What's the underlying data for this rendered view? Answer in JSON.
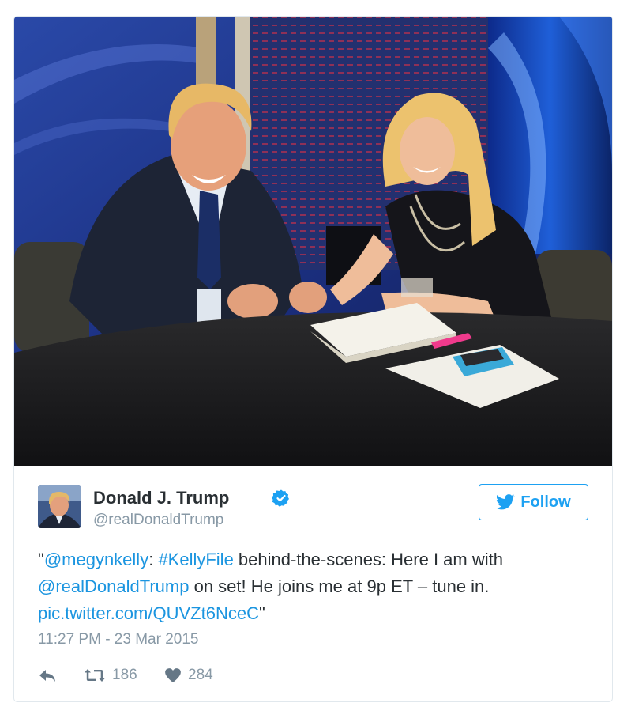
{
  "author": {
    "display_name": "Donald J. Trump",
    "handle": "@realDonaldTrump",
    "verified": true
  },
  "follow_button": {
    "label": "Follow"
  },
  "tweet": {
    "quote_open": "\"",
    "mention_1": "@megynkelly",
    "colon": ": ",
    "hashtag": "#KellyFile",
    "text_1": " behind-the-scenes: Here I am with ",
    "mention_2": "@realDonaldTrump",
    "text_2": " on set! He joins me at 9p ET – tune in. ",
    "link": "pic.twitter.com/QUVZt6NceC",
    "quote_close": "\""
  },
  "timestamp": "11:27 PM - 23 Mar 2015",
  "stats": {
    "retweets": "186",
    "likes": "284"
  },
  "icons": {
    "reply": "reply-icon",
    "retweet": "retweet-icon",
    "like": "heart-icon",
    "verified": "verified-badge-icon",
    "bird": "twitter-bird-icon"
  },
  "colors": {
    "accent": "#1da1f2",
    "link": "#1b95e0",
    "text": "#292f33",
    "muted": "#8899a6"
  }
}
